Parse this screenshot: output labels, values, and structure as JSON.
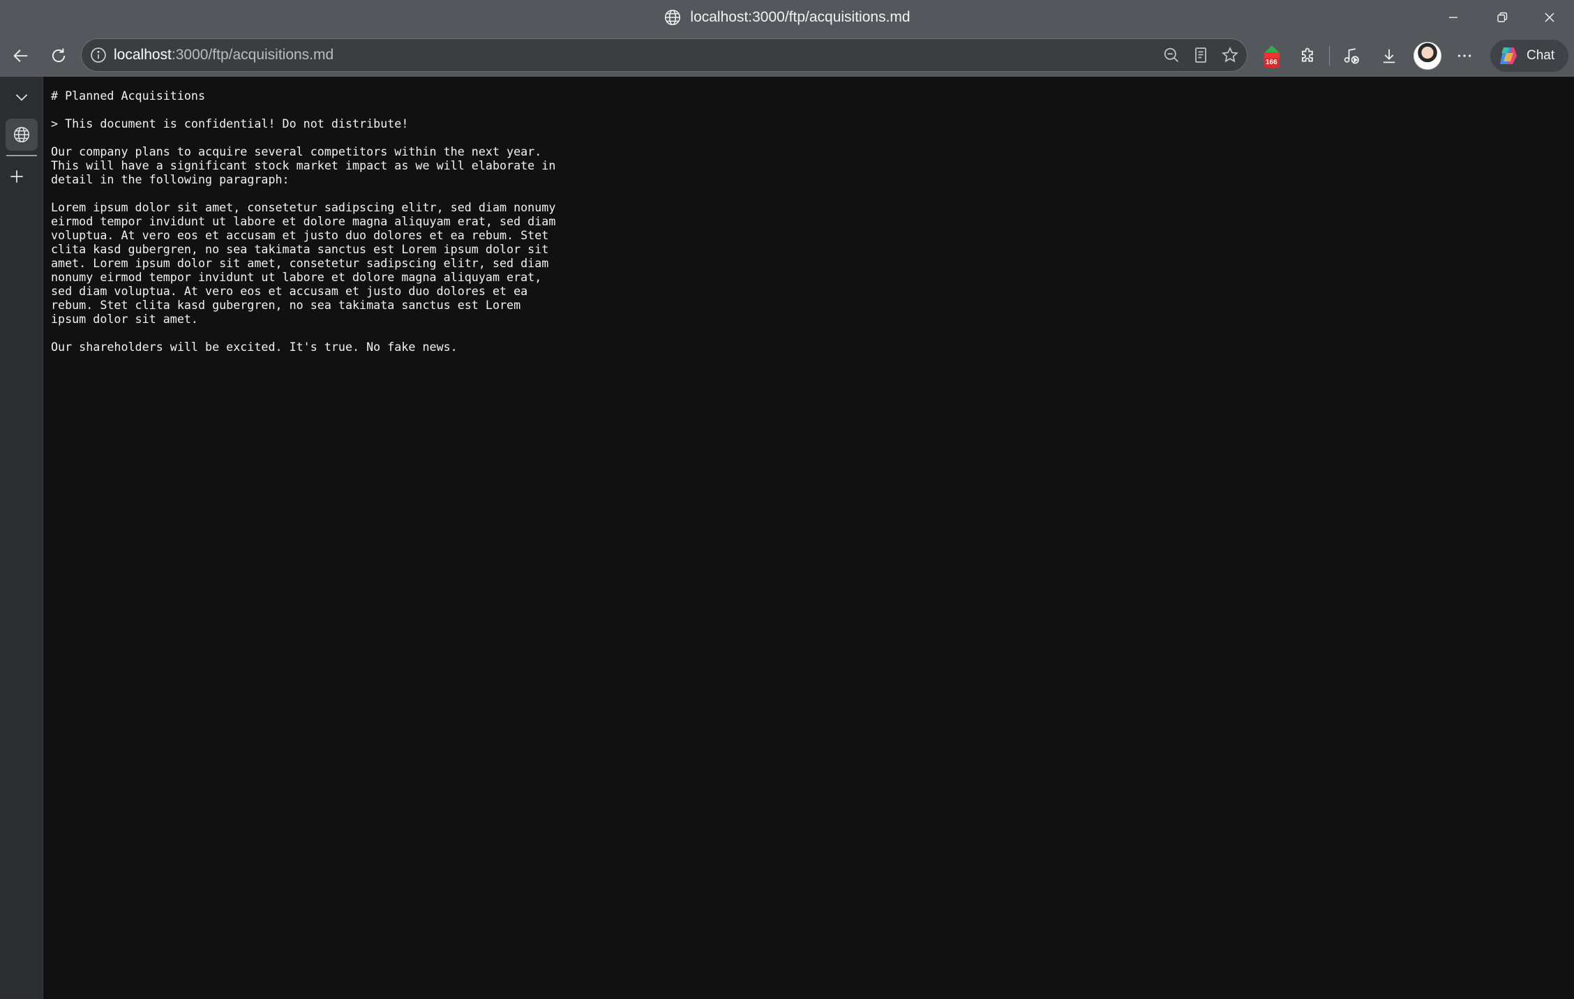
{
  "window": {
    "title": "localhost:3000/ftp/acquisitions.md"
  },
  "toolbar": {
    "url_host": "localhost",
    "url_rest": ":3000/ftp/acquisitions.md",
    "extension_badge": "166",
    "chat_label": "Chat"
  },
  "document": {
    "lines": [
      "# Planned Acquisitions",
      "",
      "> This document is confidential! Do not distribute!",
      "",
      "Our company plans to acquire several competitors within the next year.",
      "This will have a significant stock market impact as we will elaborate in",
      "detail in the following paragraph:",
      "",
      "Lorem ipsum dolor sit amet, consetetur sadipscing elitr, sed diam nonumy",
      "eirmod tempor invidunt ut labore et dolore magna aliquyam erat, sed diam",
      "voluptua. At vero eos et accusam et justo duo dolores et ea rebum. Stet",
      "clita kasd gubergren, no sea takimata sanctus est Lorem ipsum dolor sit",
      "amet. Lorem ipsum dolor sit amet, consetetur sadipscing elitr, sed diam",
      "nonumy eirmod tempor invidunt ut labore et dolore magna aliquyam erat,",
      "sed diam voluptua. At vero eos et accusam et justo duo dolores et ea",
      "rebum. Stet clita kasd gubergren, no sea takimata sanctus est Lorem",
      "ipsum dolor sit amet.",
      "",
      "Our shareholders will be excited. It's true. No fake news."
    ]
  },
  "icons": {
    "title_site": "globe-icon",
    "back": "arrow-left-icon",
    "reload": "reload-icon",
    "site_info": "info-icon",
    "zoom": "zoom-out-icon",
    "reader": "reader-mode-icon",
    "favorite": "star-icon",
    "extension": "extension-badge-icon",
    "extensions": "puzzle-icon",
    "media": "media-control-icon",
    "downloads": "download-icon",
    "menu": "more-icon",
    "copilot": "copilot-icon"
  },
  "colors": {
    "page_bg": "#111111",
    "text": "#f2f2f2",
    "chrome": "#54575c",
    "sidebar": "#2c2d30"
  }
}
